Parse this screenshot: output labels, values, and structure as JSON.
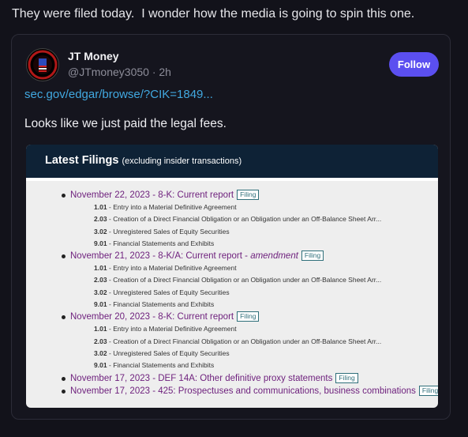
{
  "post": {
    "text": "They were filed today.  I wonder how the media is going to spin this one."
  },
  "embed": {
    "author_name": "JT Money",
    "author_handle": "@JTmoney3050 · 2h",
    "follow_label": "Follow",
    "link_text": "sec.gov/edgar/browse/?CIK=1849...",
    "body": "Looks like we just paid the legal fees.",
    "screenshot": {
      "title": "Latest Filings",
      "subtitle": "(excluding insider transactions)",
      "badge": "Filing",
      "filings": [
        {
          "title": "November 22, 2023 - 8-K: Current report",
          "amend": "",
          "items": [
            {
              "code": "1.01",
              "desc": "- Entry into a Material Definitive Agreement"
            },
            {
              "code": "2.03",
              "desc": "- Creation of a Direct Financial Obligation or an Obligation under an Off-Balance Sheet Arr..."
            },
            {
              "code": "3.02",
              "desc": "- Unregistered Sales of Equity Securities"
            },
            {
              "code": "9.01",
              "desc": "- Financial Statements and Exhibits"
            }
          ]
        },
        {
          "title": "November 21, 2023 - 8-K/A: Current report - ",
          "amend": "amendment",
          "items": [
            {
              "code": "1.01",
              "desc": "- Entry into a Material Definitive Agreement"
            },
            {
              "code": "2.03",
              "desc": "- Creation of a Direct Financial Obligation or an Obligation under an Off-Balance Sheet Arr..."
            },
            {
              "code": "3.02",
              "desc": "- Unregistered Sales of Equity Securities"
            },
            {
              "code": "9.01",
              "desc": "- Financial Statements and Exhibits"
            }
          ]
        },
        {
          "title": "November 20, 2023 - 8-K: Current report",
          "amend": "",
          "items": [
            {
              "code": "1.01",
              "desc": "- Entry into a Material Definitive Agreement"
            },
            {
              "code": "2.03",
              "desc": "- Creation of a Direct Financial Obligation or an Obligation under an Off-Balance Sheet Arr..."
            },
            {
              "code": "3.02",
              "desc": "- Unregistered Sales of Equity Securities"
            },
            {
              "code": "9.01",
              "desc": "- Financial Statements and Exhibits"
            }
          ]
        },
        {
          "title": "November 17, 2023 - DEF 14A: Other definitive proxy statements",
          "amend": "",
          "items": []
        },
        {
          "title": "November 17, 2023 - 425: Prospectuses and communications, business combinations",
          "amend": "",
          "items": []
        }
      ]
    }
  }
}
